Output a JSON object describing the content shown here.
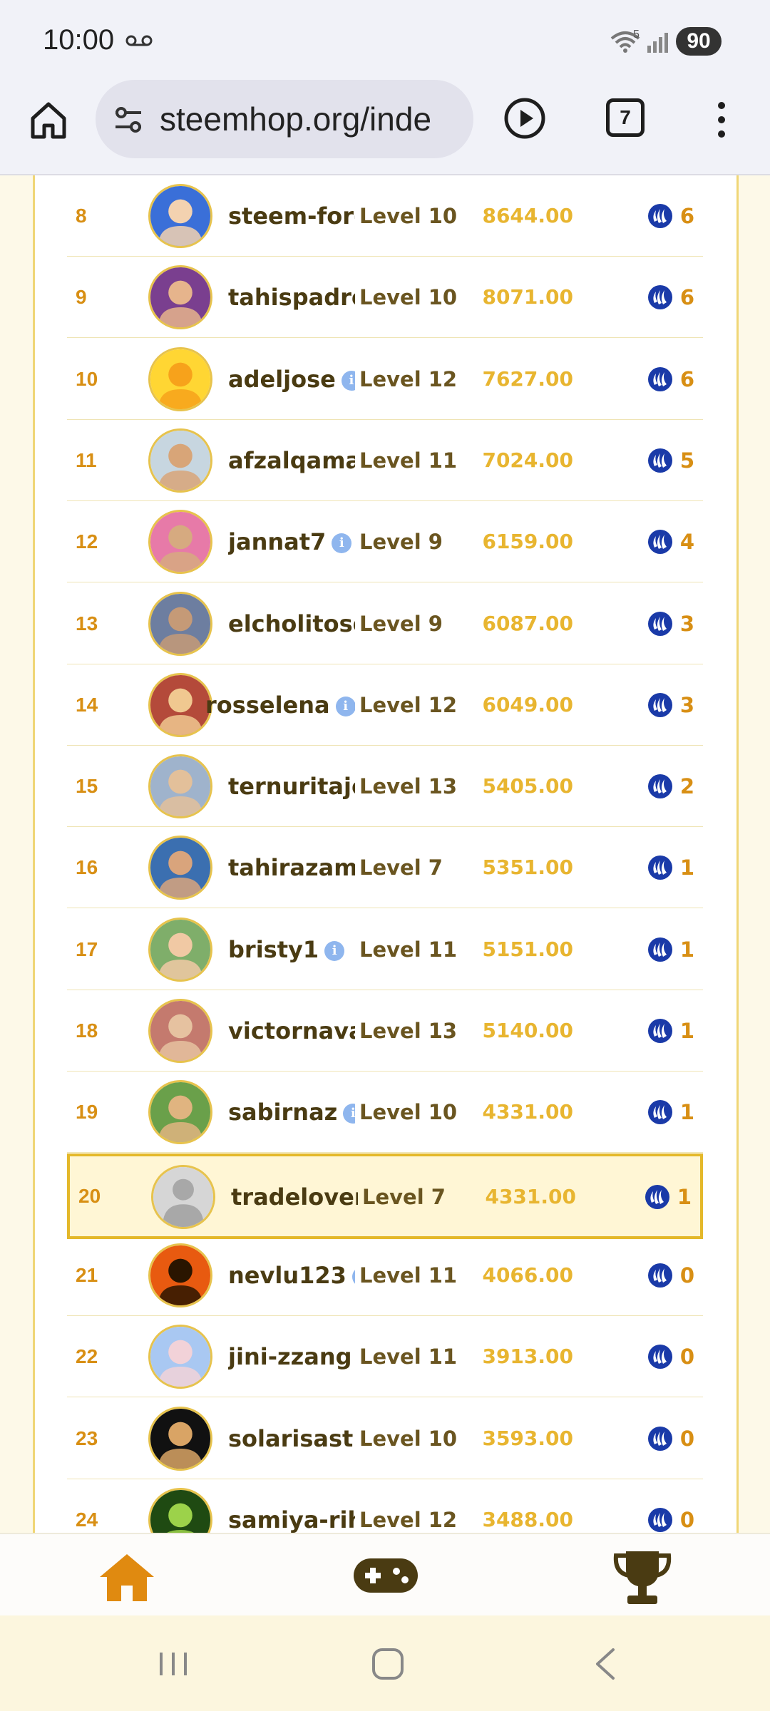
{
  "status_bar": {
    "time": "10:00",
    "wifi_badge": "5",
    "battery": "90"
  },
  "browser": {
    "url": "steemhop.org/inde",
    "tab_count": "7"
  },
  "leaderboard": [
    {
      "rank": "8",
      "name": "steem-for-",
      "info": false,
      "level": "Level 10",
      "score": "8644.00",
      "reward": "6",
      "highlight": false
    },
    {
      "rank": "9",
      "name": "tahispadro",
      "info": false,
      "level": "Level 10",
      "score": "8071.00",
      "reward": "6",
      "highlight": false
    },
    {
      "rank": "10",
      "name": "adeljose",
      "info": true,
      "level": "Level 12",
      "score": "7627.00",
      "reward": "6",
      "highlight": false
    },
    {
      "rank": "11",
      "name": "afzalqama",
      "info": false,
      "level": "Level 11",
      "score": "7024.00",
      "reward": "5",
      "highlight": false
    },
    {
      "rank": "12",
      "name": "jannat7",
      "info": true,
      "level": "Level 9",
      "score": "6159.00",
      "reward": "4",
      "highlight": false
    },
    {
      "rank": "13",
      "name": "elcholitoso",
      "info": false,
      "level": "Level 9",
      "score": "6087.00",
      "reward": "3",
      "highlight": false
    },
    {
      "rank": "14",
      "name": "rosselena",
      "info": true,
      "level": "Level 12",
      "score": "6049.00",
      "reward": "3",
      "highlight": false
    },
    {
      "rank": "15",
      "name": "ternuritaje",
      "info": false,
      "level": "Level 13",
      "score": "5405.00",
      "reward": "2",
      "highlight": false
    },
    {
      "rank": "16",
      "name": "tahirazam",
      "info": false,
      "level": "Level 7",
      "score": "5351.00",
      "reward": "1",
      "highlight": false
    },
    {
      "rank": "17",
      "name": "bristy1",
      "info": true,
      "level": "Level 11",
      "score": "5151.00",
      "reward": "1",
      "highlight": false
    },
    {
      "rank": "18",
      "name": "victornava",
      "info": false,
      "level": "Level 13",
      "score": "5140.00",
      "reward": "1",
      "highlight": false
    },
    {
      "rank": "19",
      "name": "sabirnaz",
      "info": true,
      "level": "Level 10",
      "score": "4331.00",
      "reward": "1",
      "highlight": false
    },
    {
      "rank": "20",
      "name": "tradelover",
      "info": false,
      "level": "Level 7",
      "score": "4331.00",
      "reward": "1",
      "highlight": true
    },
    {
      "rank": "21",
      "name": "nevlu123",
      "info": true,
      "level": "Level 11",
      "score": "4066.00",
      "reward": "0",
      "highlight": false
    },
    {
      "rank": "22",
      "name": "jini-zzang",
      "info": true,
      "level": "Level 11",
      "score": "3913.00",
      "reward": "0",
      "highlight": false
    },
    {
      "rank": "23",
      "name": "solarisastr",
      "info": false,
      "level": "Level 10",
      "score": "3593.00",
      "reward": "0",
      "highlight": false
    },
    {
      "rank": "24",
      "name": "samiya-rih",
      "info": false,
      "level": "Level 12",
      "score": "3488.00",
      "reward": "0",
      "highlight": false
    }
  ],
  "colors": {
    "rank": "#d88f14",
    "name": "#4a3b12",
    "level": "#6a5520",
    "score": "#e8b530",
    "steem": "#1a3aa8",
    "highlight_border": "#e4b82a",
    "highlight_bg": "#fff6d5",
    "nav_active": "#e08a10",
    "nav_inactive": "#4a3b12"
  },
  "bottom_nav": [
    {
      "icon": "home-icon",
      "active": true
    },
    {
      "icon": "gamepad-icon",
      "active": false
    },
    {
      "icon": "trophy-icon",
      "active": false
    }
  ]
}
